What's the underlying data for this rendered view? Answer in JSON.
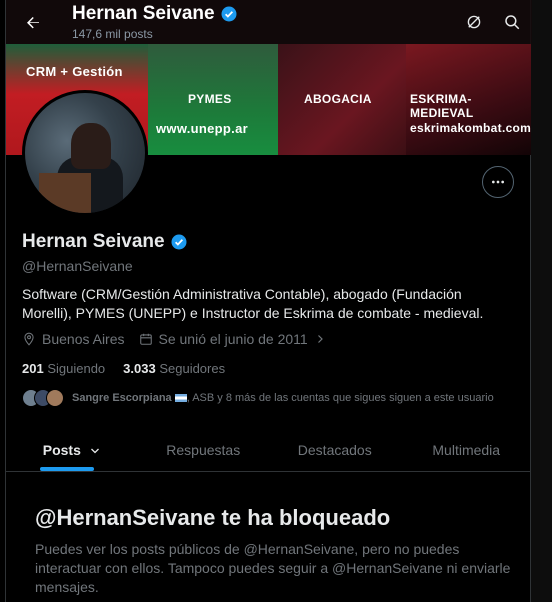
{
  "header": {
    "name": "Hernan Seivane",
    "posts_count": "147,6 mil posts"
  },
  "banner": {
    "segments": [
      "CRM + Gestión",
      "PYMES",
      "ABOGACIA",
      "ESKRIMA-MEDIEVAL"
    ],
    "urls": [
      "www.unepp.ar",
      "eskrimakombat.com"
    ]
  },
  "profile": {
    "name": "Hernan Seivane",
    "handle": "@HernanSeivane",
    "bio": "Software (CRM/Gestión Administrativa Contable), abogado (Fundación Morelli), PYMES (UNEPP) e Instructor de Eskrima de combate - medieval.",
    "location": "Buenos Aires",
    "joined": "Se unió el junio de 2011",
    "following_count": "201",
    "following_label": "Siguiendo",
    "followers_count": "3.033",
    "followers_label": "Seguidores",
    "followed_by_name": "Sangre Escorpiana",
    "followed_by_rest": ", ASB y 8 más de las cuentas que sigues siguen a este usuario"
  },
  "tabs": [
    "Posts",
    "Respuestas",
    "Destacados",
    "Multimedia"
  ],
  "blocked": {
    "title": "@HernanSeivane te ha bloqueado",
    "text": "Puedes ver los posts públicos de @HernanSeivane, pero no puedes interactuar con ellos. Tampoco puedes seguir a @HernanSeivane ni enviarle mensajes."
  },
  "colors": {
    "accent": "#1d9bf0",
    "verified": "#1d9bf0"
  }
}
